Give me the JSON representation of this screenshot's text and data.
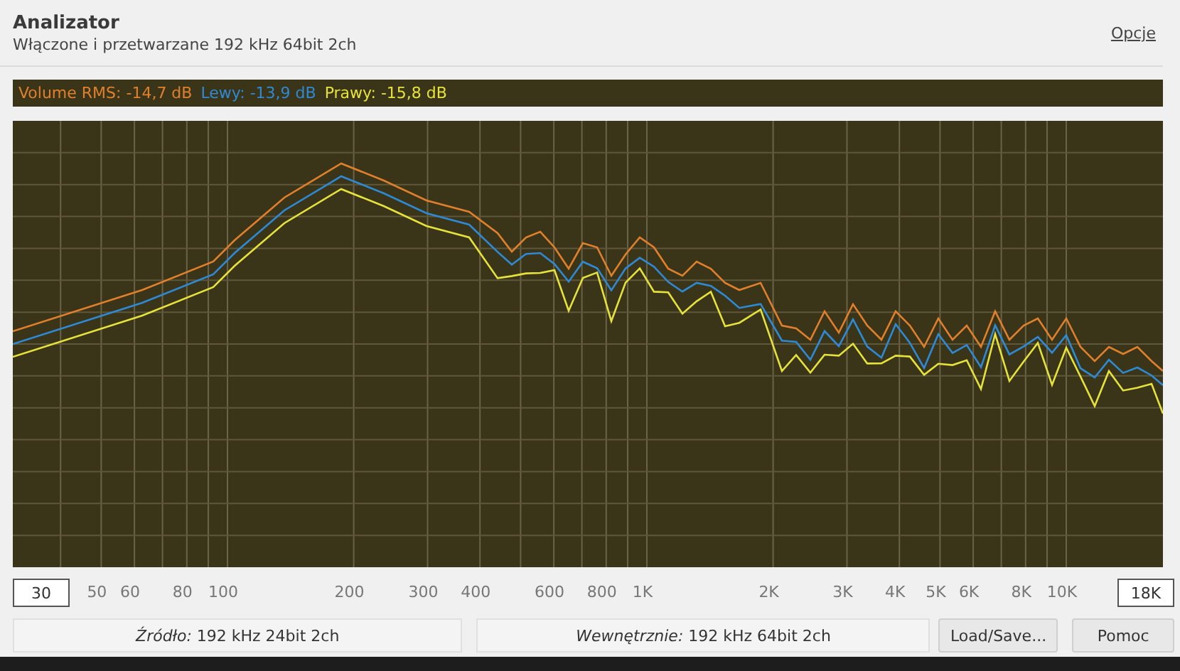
{
  "header": {
    "title": "Analizator",
    "subtitle": "Włączone i przetwarzane 192 kHz 64bit 2ch",
    "options_link": "Opcje"
  },
  "readings": [
    {
      "label": "Volume RMS: -14,7 dB",
      "color": "#e0802c"
    },
    {
      "label": "Lewy: -13,9 dB",
      "color": "#2f8ad6"
    },
    {
      "label": "Prawy: -15,8 dB",
      "color": "#e6e23c"
    }
  ],
  "range": {
    "min": "30",
    "max": "18K"
  },
  "x_labels": [
    "50",
    "60",
    "80",
    "100",
    "200",
    "300",
    "400",
    "600",
    "800",
    "1K",
    "2K",
    "3K",
    "4K",
    "5K",
    "6K",
    "8K",
    "10K"
  ],
  "status": {
    "source": "*Źródło:* 192 kHz 24bit 2ch",
    "internal": "*Wewnętrznie:* 192 kHz 64bit 2ch"
  },
  "buttons": [
    "Load/Save...",
    "Pomoc"
  ]
}
